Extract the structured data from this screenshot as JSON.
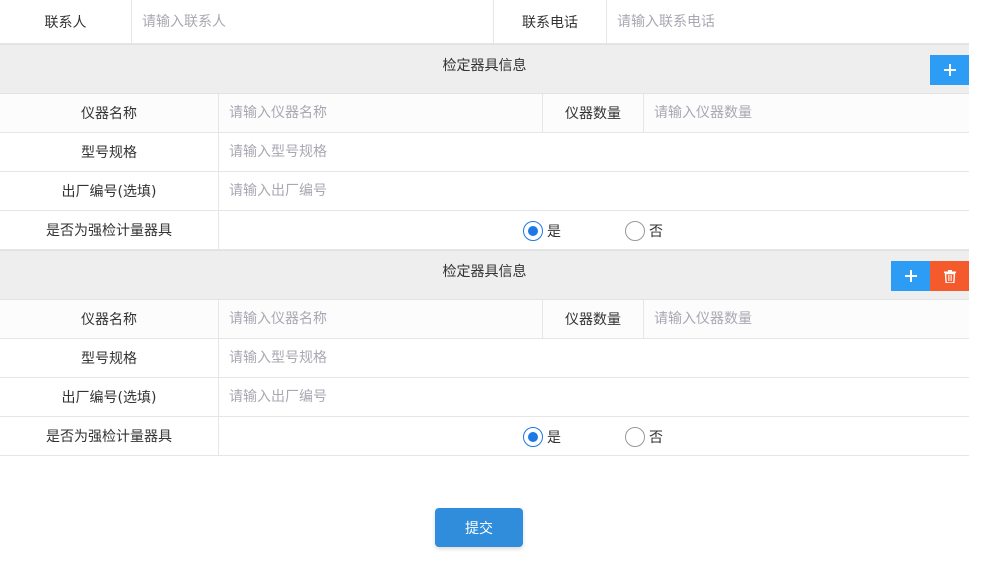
{
  "contact": {
    "name_label": "联系人",
    "name_placeholder": "请输入联系人",
    "phone_label": "联系电话",
    "phone_placeholder": "请输入联系电话"
  },
  "sections": [
    {
      "title": "检定器具信息",
      "show_delete": false,
      "instrument_name_label": "仪器名称",
      "instrument_name_placeholder": "请输入仪器名称",
      "quantity_label": "仪器数量",
      "quantity_placeholder": "请输入仪器数量",
      "model_label": "型号规格",
      "model_placeholder": "请输入型号规格",
      "serial_label": "出厂编号(选填)",
      "serial_placeholder": "请输入出厂编号",
      "mandatory_label": "是否为强检计量器具",
      "yes_label": "是",
      "no_label": "否",
      "selected": "yes"
    },
    {
      "title": "检定器具信息",
      "show_delete": true,
      "instrument_name_label": "仪器名称",
      "instrument_name_placeholder": "请输入仪器名称",
      "quantity_label": "仪器数量",
      "quantity_placeholder": "请输入仪器数量",
      "model_label": "型号规格",
      "model_placeholder": "请输入型号规格",
      "serial_label": "出厂编号(选填)",
      "serial_placeholder": "请输入出厂编号",
      "mandatory_label": "是否为强检计量器具",
      "yes_label": "是",
      "no_label": "否",
      "selected": "yes"
    }
  ],
  "submit_label": "提交",
  "colors": {
    "add_button": "#2d9cf4",
    "delete_button": "#f55a2c",
    "submit_button": "#2f8ddb",
    "radio_selected": "#1e78e6"
  },
  "icons": {
    "add": "plus-icon",
    "delete": "trash-icon"
  }
}
